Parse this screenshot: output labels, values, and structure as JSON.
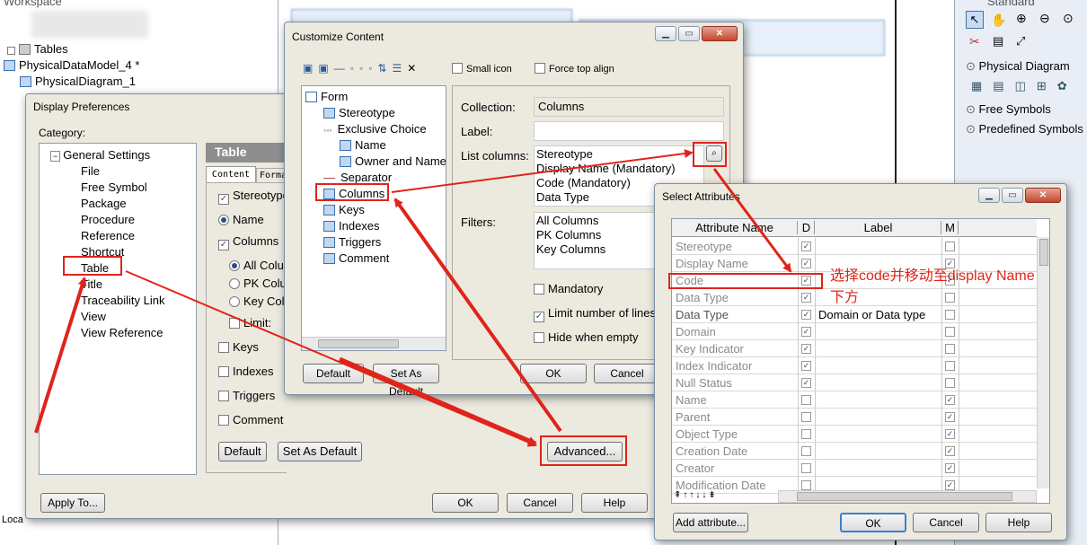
{
  "workspace": {
    "title": "Workspace",
    "tree": [
      "Tables",
      "PhysicalDataModel_4 *",
      "PhysicalDiagram_1"
    ],
    "status_text": "Loca"
  },
  "toolbox": {
    "header": "Standard",
    "sections": [
      "Physical Diagram",
      "Free Symbols",
      "Predefined Symbols"
    ]
  },
  "display_prefs": {
    "title": "Display Preferences",
    "category_label": "Category:",
    "tree_root": "General Settings",
    "tree_items": [
      "File",
      "Free Symbol",
      "Package",
      "Procedure",
      "Reference",
      "Shortcut",
      "Table",
      "Title",
      "Traceability Link",
      "View",
      "View Reference"
    ],
    "panel_title": "Table",
    "tabs": [
      "Content",
      "Forma"
    ],
    "options": {
      "stereotype": "Stereotype",
      "name": "Name",
      "columns": "Columns",
      "all_columns": "All Colu",
      "pk_columns": "PK Colu",
      "key_columns": "Key Col",
      "limit": "Limit:",
      "keys": "Keys",
      "indexes": "Indexes",
      "triggers": "Triggers",
      "comment": "Comment"
    },
    "buttons": {
      "default": "Default",
      "set_as_default": "Set As Default",
      "advanced": "Advanced...",
      "apply_to": "Apply To...",
      "ok": "OK",
      "cancel": "Cancel",
      "help": "Help"
    }
  },
  "customize": {
    "title": "Customize Content",
    "small_icon": "Small icon",
    "force_top_align": "Force top align",
    "tree": [
      "Form",
      "Stereotype",
      "Exclusive Choice",
      "Name",
      "Owner and Name",
      "Separator",
      "Columns",
      "Keys",
      "Indexes",
      "Triggers",
      "Comment"
    ],
    "collection_label": "Collection:",
    "collection_value": "Columns",
    "label_label": "Label:",
    "list_columns_label": "List columns:",
    "list_columns": [
      "Stereotype",
      "Display Name (Mandatory)",
      "Code (Mandatory)",
      "Data Type"
    ],
    "filters_label": "Filters:",
    "filters": [
      "All Columns",
      "PK Columns",
      "Key Columns"
    ],
    "mandatory": "Mandatory",
    "limit_lines": "Limit number of lines",
    "hide_empty": "Hide when empty",
    "buttons": {
      "default": "Default",
      "set_as_default": "Set As Default",
      "ok": "OK",
      "cancel": "Cancel"
    }
  },
  "select_attr": {
    "title": "Select Attributes",
    "headers": [
      "Attribute Name",
      "D",
      "Label",
      "M"
    ],
    "rows": [
      {
        "name": "Stereotype",
        "d": true,
        "label": "",
        "m": false
      },
      {
        "name": "Display Name",
        "d": true,
        "label": "",
        "m": true
      },
      {
        "name": "Code",
        "d": true,
        "label": "",
        "m": true
      },
      {
        "name": "Data Type",
        "d": true,
        "label": "",
        "m": false
      },
      {
        "name": "Data Type",
        "d": true,
        "label": "Domain or Data type",
        "m": false
      },
      {
        "name": "Domain",
        "d": true,
        "label": "",
        "m": false
      },
      {
        "name": "Key Indicator",
        "d": true,
        "label": "",
        "m": false
      },
      {
        "name": "Index Indicator",
        "d": true,
        "label": "",
        "m": false
      },
      {
        "name": "Null Status",
        "d": true,
        "label": "",
        "m": false
      },
      {
        "name": "Name",
        "d": false,
        "label": "",
        "m": true
      },
      {
        "name": "Parent",
        "d": false,
        "label": "",
        "m": true
      },
      {
        "name": "Object Type",
        "d": false,
        "label": "",
        "m": true
      },
      {
        "name": "Creation Date",
        "d": false,
        "label": "",
        "m": true
      },
      {
        "name": "Creator",
        "d": false,
        "label": "",
        "m": true
      },
      {
        "name": "Modification Date",
        "d": false,
        "label": "",
        "m": true
      }
    ],
    "buttons": {
      "add_attribute": "Add attribute...",
      "ok": "OK",
      "cancel": "Cancel",
      "help": "Help"
    }
  },
  "annotation": {
    "line1": "选择code并移动至display Name",
    "line2": "下方"
  },
  "colors": {
    "highlight": "#e0241b"
  }
}
